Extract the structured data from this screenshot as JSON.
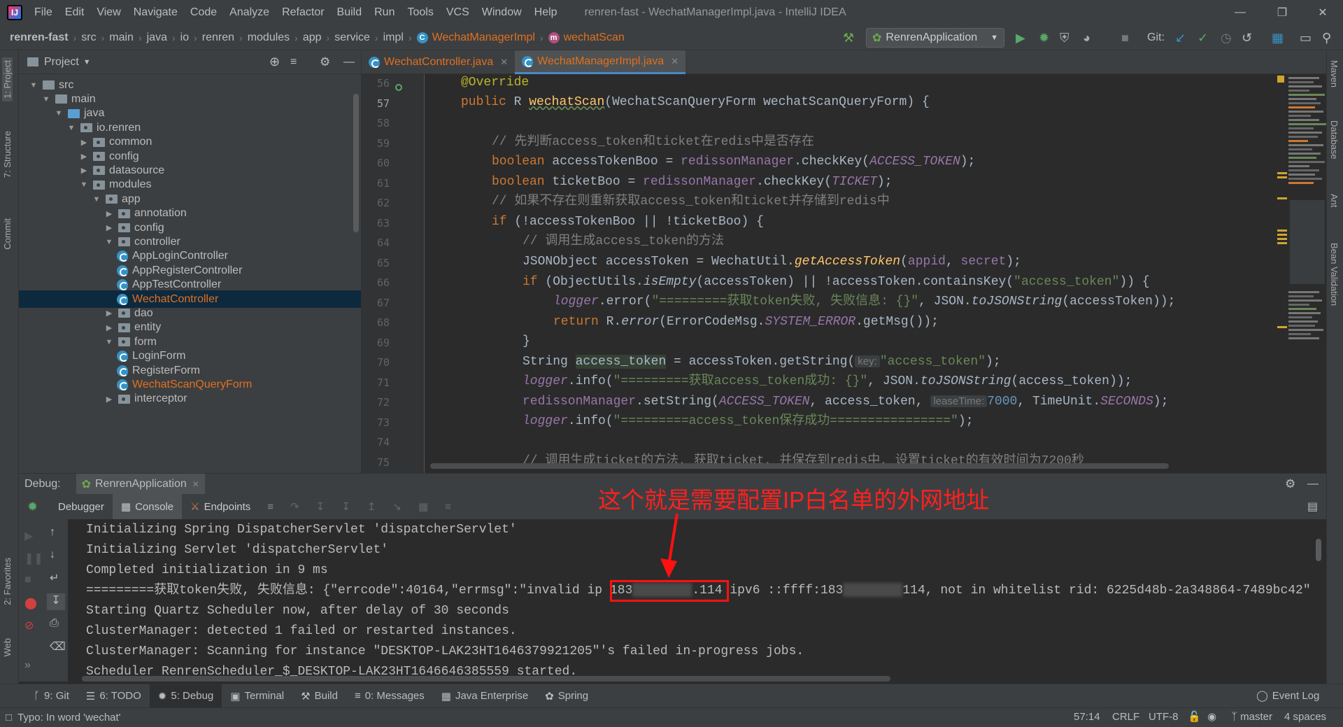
{
  "window": {
    "title": "renren-fast - WechatManagerImpl.java - IntelliJ IDEA",
    "logo": "IJ",
    "menu": [
      "File",
      "Edit",
      "View",
      "Navigate",
      "Code",
      "Analyze",
      "Refactor",
      "Build",
      "Run",
      "Tools",
      "VCS",
      "Window",
      "Help"
    ]
  },
  "breadcrumbs": [
    "renren-fast",
    "src",
    "main",
    "java",
    "io",
    "renren",
    "modules",
    "app",
    "service",
    "impl",
    "WechatManagerImpl",
    "wechatScan"
  ],
  "toolbar": {
    "run_config": "RenrenApplication",
    "git_label": "Git:"
  },
  "project": {
    "header": "Project",
    "tree": [
      {
        "label": "src",
        "depth": 0,
        "open": true,
        "kind": "folder"
      },
      {
        "label": "main",
        "depth": 1,
        "open": true,
        "kind": "folder"
      },
      {
        "label": "java",
        "depth": 2,
        "open": true,
        "kind": "src"
      },
      {
        "label": "io.renren",
        "depth": 3,
        "open": true,
        "kind": "pkg"
      },
      {
        "label": "common",
        "depth": 4,
        "open": false,
        "kind": "pkg"
      },
      {
        "label": "config",
        "depth": 4,
        "open": false,
        "kind": "pkg"
      },
      {
        "label": "datasource",
        "depth": 4,
        "open": false,
        "kind": "pkg"
      },
      {
        "label": "modules",
        "depth": 4,
        "open": true,
        "kind": "pkg"
      },
      {
        "label": "app",
        "depth": 5,
        "open": true,
        "kind": "pkg"
      },
      {
        "label": "annotation",
        "depth": 6,
        "open": false,
        "kind": "pkg"
      },
      {
        "label": "config",
        "depth": 6,
        "open": false,
        "kind": "pkg"
      },
      {
        "label": "controller",
        "depth": 6,
        "open": true,
        "kind": "pkg"
      },
      {
        "label": "AppLoginController",
        "depth": 7,
        "kind": "class"
      },
      {
        "label": "AppRegisterController",
        "depth": 7,
        "kind": "class"
      },
      {
        "label": "AppTestController",
        "depth": 7,
        "kind": "class"
      },
      {
        "label": "WechatController",
        "depth": 7,
        "kind": "class",
        "selected": true,
        "modified": true
      },
      {
        "label": "dao",
        "depth": 6,
        "open": false,
        "kind": "pkg"
      },
      {
        "label": "entity",
        "depth": 6,
        "open": false,
        "kind": "pkg"
      },
      {
        "label": "form",
        "depth": 6,
        "open": true,
        "kind": "pkg"
      },
      {
        "label": "LoginForm",
        "depth": 7,
        "kind": "class"
      },
      {
        "label": "RegisterForm",
        "depth": 7,
        "kind": "class"
      },
      {
        "label": "WechatScanQueryForm",
        "depth": 7,
        "kind": "class",
        "modified": true
      },
      {
        "label": "interceptor",
        "depth": 6,
        "open": false,
        "kind": "pkg"
      }
    ]
  },
  "editor_tabs": [
    {
      "label": "WechatController.java",
      "active": false
    },
    {
      "label": "WechatManagerImpl.java",
      "active": true
    }
  ],
  "editor": {
    "line_numbers": [
      "56",
      "57",
      "58",
      "59",
      "60",
      "61",
      "62",
      "63",
      "64",
      "65",
      "66",
      "67",
      "68",
      "69",
      "70",
      "71",
      "72",
      "73",
      "74",
      "75"
    ],
    "code": {
      "l56": "@Override",
      "l57_kw": "public ",
      "l57_type": "R ",
      "l57_fn": "wechatScan",
      "l57_rest": "(WechatScanQueryForm wechatScanQueryForm) {",
      "l59": "// 先判断access_token和ticket在redis中是否存在",
      "l60_kw": "boolean ",
      "l60_a": "accessTokenBoo = ",
      "l60_b": "redissonManager",
      "l60_c": ".checkKey(",
      "l60_f": "ACCESS_TOKEN",
      "l60_d": ");",
      "l61_kw": "boolean ",
      "l61_a": "ticketBoo = ",
      "l61_b": "redissonManager",
      "l61_c": ".checkKey(",
      "l61_f": "TICKET",
      "l61_d": ");",
      "l62": "// 如果不存在则重新获取access_token和ticket并存储到redis中",
      "l63_kw": "if ",
      "l63_a": "(!accessTokenBoo || !ticketBoo) {",
      "l64": "// 调用生成access_token的方法",
      "l65_a": "JSONObject accessToken = WechatUtil.",
      "l65_it": "getAccessToken",
      "l65_b": "(",
      "l65_c": "appid",
      "l65_d": ", ",
      "l65_e": "secret",
      "l65_g": ");",
      "l66_kw": "if ",
      "l66_a": "(ObjectUtils.",
      "l66_it": "isEmpty",
      "l66_b": "(accessToken) || !accessToken.containsKey(",
      "l66_s": "\"access_token\"",
      "l66_c": ")) {",
      "l67_f": "logger",
      "l67_a": ".error(",
      "l67_s": "\"=========获取token失败, 失败信息: {}\"",
      "l67_b": ", JSON.",
      "l67_it": "toJSONString",
      "l67_c": "(accessToken));",
      "l68_kw": "return ",
      "l68_a": "R.",
      "l68_it": "error",
      "l68_b": "(ErrorCodeMsg.",
      "l68_f": "SYSTEM_ERROR",
      "l68_c": ".getMsg());",
      "l69": "}",
      "l70_a": "String ",
      "l70_h": "access_token",
      "l70_b": " = accessToken.getString(",
      "l70_hint": "key:",
      "l70_s": "\"access_token\"",
      "l70_c": ");",
      "l71_f": "logger",
      "l71_a": ".info(",
      "l71_s": "\"=========获取access_token成功: {}\"",
      "l71_b": ", JSON.",
      "l71_it": "toJSONString",
      "l71_c": "(access_token));",
      "l72_f": "redissonManager",
      "l72_a": ".setString(",
      "l72_f2": "ACCESS_TOKEN",
      "l72_b": ", access_token, ",
      "l72_hint": "leaseTime:",
      "l72_n": "7000",
      "l72_c": ", TimeUnit.",
      "l72_f3": "SECONDS",
      "l72_d": ");",
      "l73_f": "logger",
      "l73_a": ".info(",
      "l73_s": "\"=========access_token保存成功================\"",
      "l73_c": ");",
      "l75": "// 调用生成ticket的方法, 获取ticket, 并保存到redis中, 设置ticket的有效时间为7200秒"
    }
  },
  "debug": {
    "label": "Debug:",
    "session": "RenrenApplication",
    "tabs": [
      "Debugger",
      "Console",
      "Endpoints"
    ],
    "console": [
      "Initializing Spring DispatcherServlet 'dispatcherServlet'",
      "Initializing Servlet 'dispatcherServlet'",
      "Completed initialization in 9 ms"
    ],
    "error_line": {
      "prefix": "=========获取token失败, 失败信息: {\"errcode\":40164,\"errmsg\":\"invalid ip ",
      "ip_start": "183",
      "ip_end": ".114",
      "mid": " ipv6 ::ffff:183",
      "tail": "114, not in whitelist rid: 6225d48b-2a348864-7489bc42\""
    },
    "console_after": [
      "Starting Quartz Scheduler now, after delay of 30 seconds",
      "ClusterManager: detected 1 failed or restarted instances.",
      "ClusterManager: Scanning for instance \"DESKTOP-LAK23HT1646379921205\"'s failed in-progress jobs.",
      "Scheduler RenrenScheduler_$_DESKTOP-LAK23HT1646646385559 started."
    ]
  },
  "annotation": "这个就是需要配置IP白名单的外网地址",
  "bottom_tabs": [
    "9: Git",
    "6: TODO",
    "5: Debug",
    "Terminal",
    "Build",
    "0: Messages",
    "Java Enterprise",
    "Spring"
  ],
  "event_log": "Event Log",
  "status": {
    "message": "Typo: In word 'wechat'",
    "position": "57:14",
    "line_sep": "CRLF",
    "encoding": "UTF-8",
    "branch": "master",
    "indent": "4 spaces"
  },
  "side_tabs": {
    "left": [
      "1: Project",
      "7: Structure",
      "Commit",
      "2: Favorites",
      "Web"
    ],
    "right": [
      "Maven",
      "Database",
      "Ant",
      "Bean Validation"
    ]
  },
  "colors": {
    "accent": "#4a88c7",
    "annotation": "#ff2020",
    "modified": "#e07020"
  }
}
